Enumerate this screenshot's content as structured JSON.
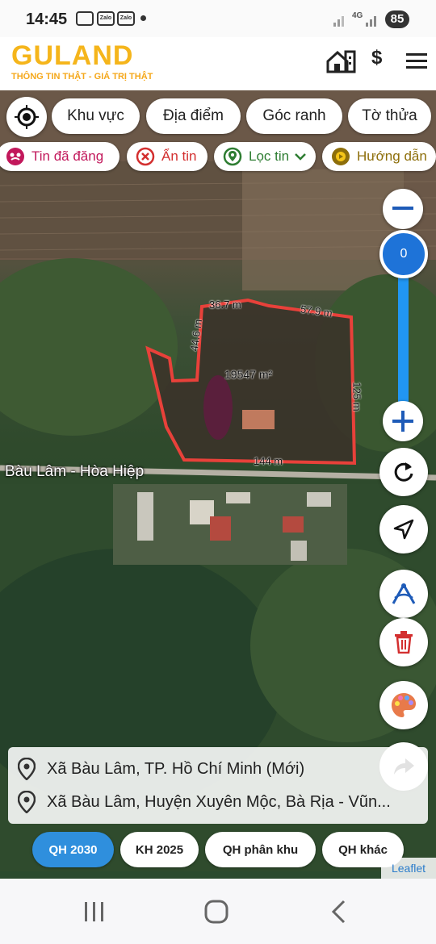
{
  "status": {
    "time": "14:45",
    "app_icons": [
      "screenshot-icon",
      "Zalo",
      "Zalo"
    ],
    "network": "4G",
    "battery": "85"
  },
  "header": {
    "logo": "GULAND",
    "slogan": "THÔNG TIN THẬT - GIÁ TRỊ THẬT",
    "icons": [
      "home-icon",
      "dollar-icon",
      "menu-icon"
    ],
    "dollar": "$"
  },
  "toolbar": {
    "row1": [
      "Khu vực",
      "Địa điểm",
      "Góc ranh",
      "Tờ thửa"
    ],
    "row2": [
      {
        "label": "Tin đã đăng",
        "icon": "posted-icon"
      },
      {
        "label": "Ẩn tin",
        "icon": "hide-icon"
      },
      {
        "label": "Lọc tin",
        "icon": "filter-location-icon"
      },
      {
        "label": "Hướng dẫn",
        "icon": "guide-icon"
      }
    ]
  },
  "map": {
    "road_label": "Bàu Lâm - Hòa Hiệp",
    "parcel": {
      "area": "19547 m²",
      "edges": [
        "36.7 m",
        "57.9 m",
        "44.6 m",
        "125 m",
        "144 m"
      ]
    },
    "zoom_value": "0",
    "colors": {
      "parcel_outline": "#e8413a",
      "zoom_accent": "#1e73d8",
      "active_tab": "#2f8fdd"
    }
  },
  "address": {
    "new": "Xã Bàu Lâm, TP. Hồ Chí Minh (Mới)",
    "old": "Xã Bàu Lâm, Huyện Xuyên Mộc, Bà Rịa - Vũn..."
  },
  "tabs": [
    "QH 2030",
    "KH 2025",
    "QH phân khu",
    "QH khác"
  ],
  "attribution": "Leaflet"
}
